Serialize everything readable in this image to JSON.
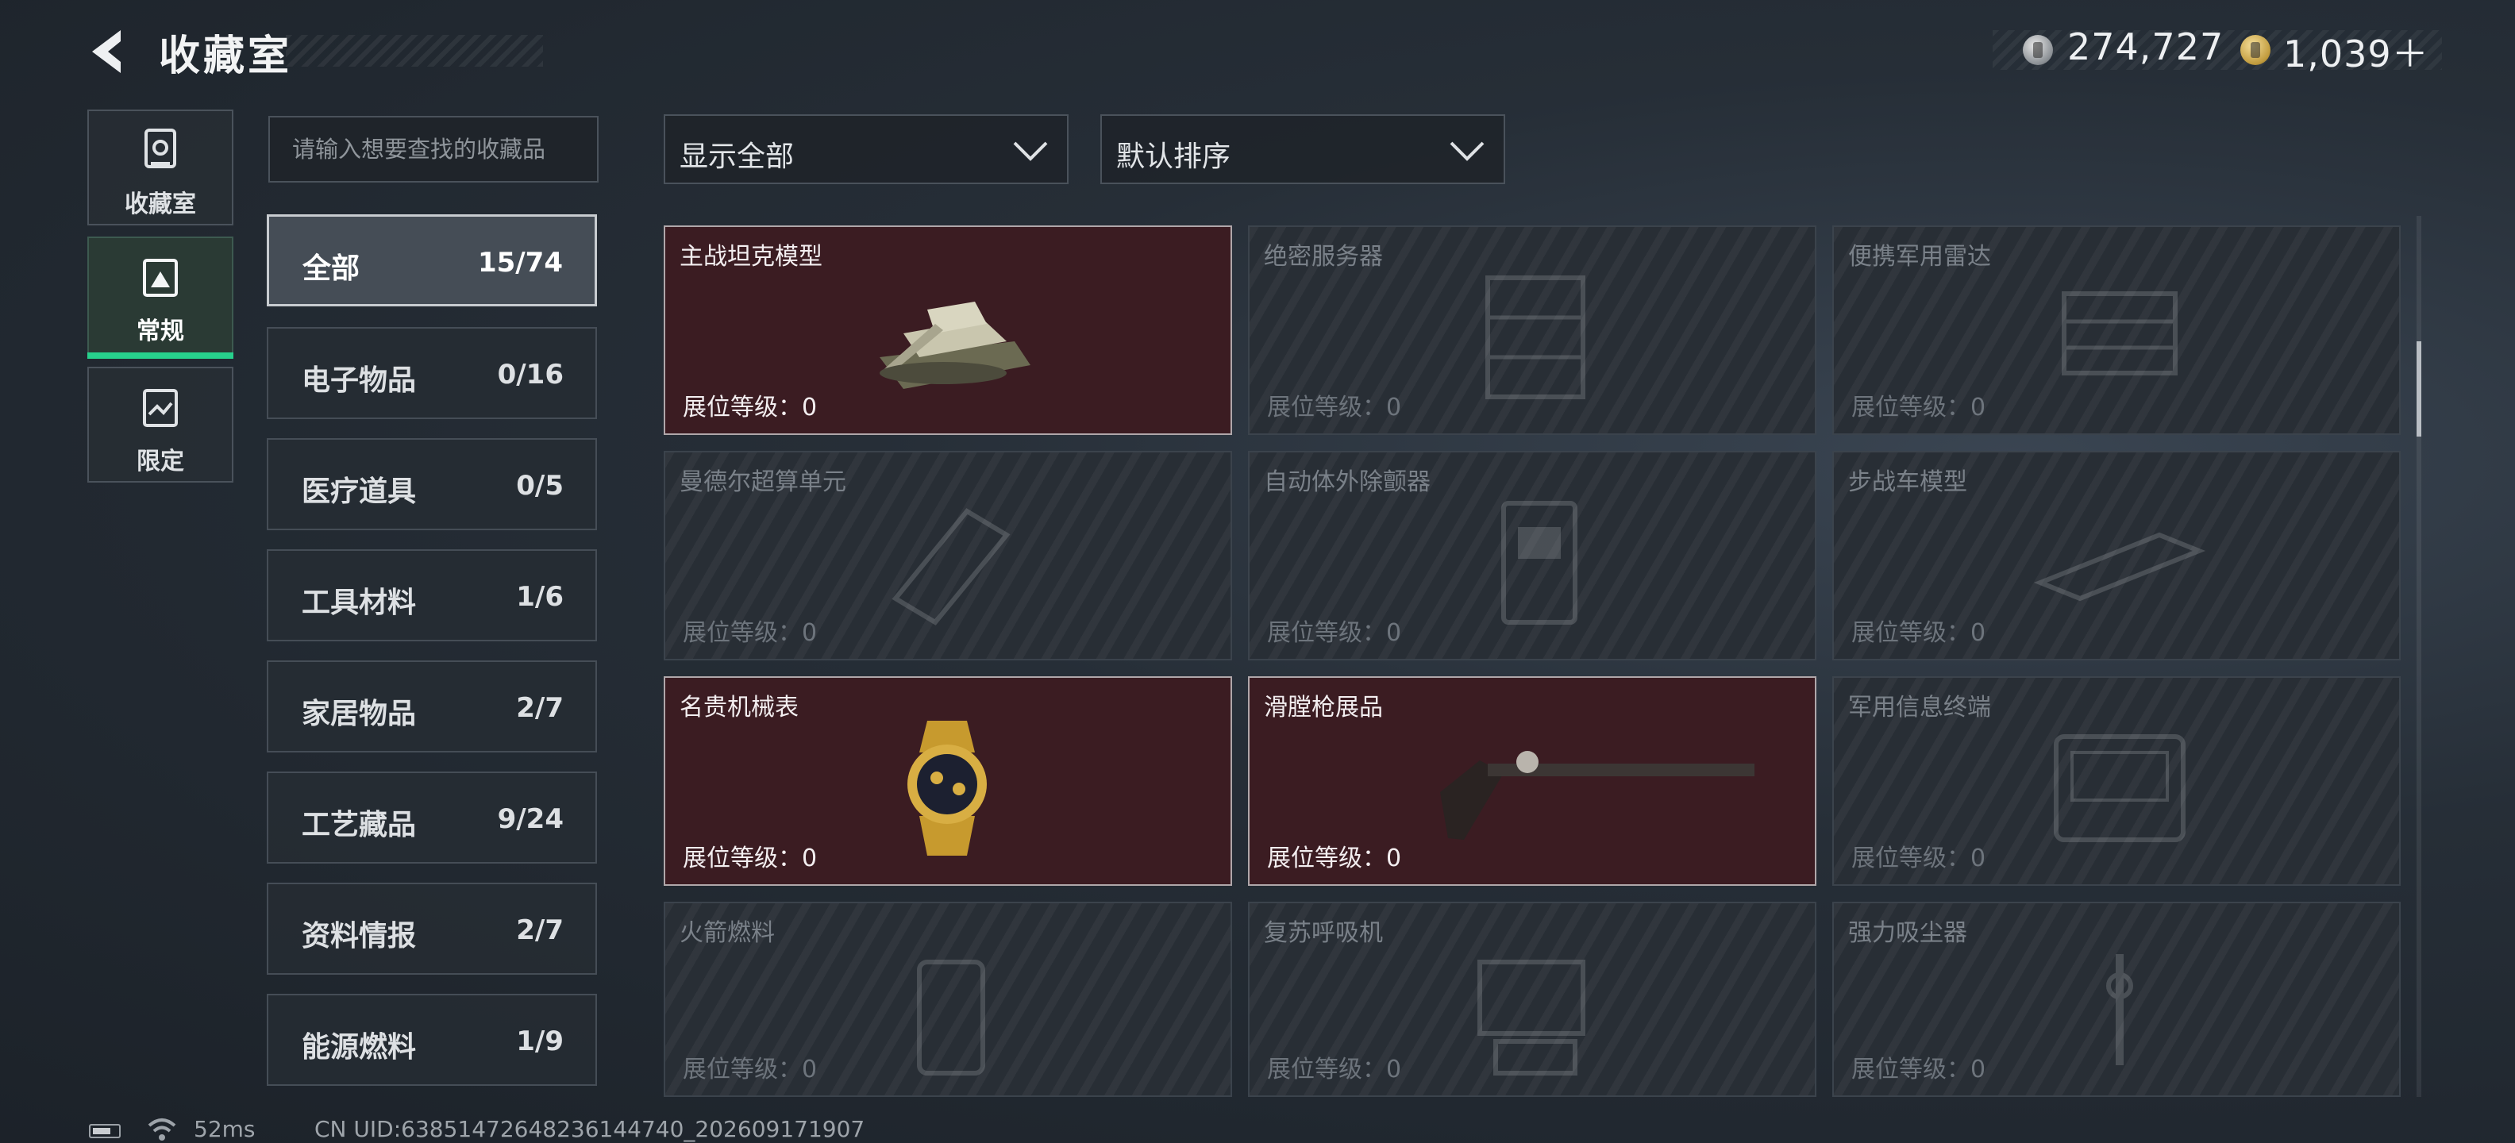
{
  "header": {
    "title": "收藏室",
    "silver_amount": "274,727",
    "gold_amount": "1,039＋"
  },
  "left_nav": [
    {
      "label": "收藏室",
      "icon": "collection-room-icon",
      "active": false
    },
    {
      "label": "常规",
      "icon": "regular-image-icon",
      "active": true
    },
    {
      "label": "限定",
      "icon": "limited-image-icon",
      "active": false
    }
  ],
  "search": {
    "placeholder": "请输入想要查找的收藏品"
  },
  "filters": {
    "filter_value": "显示全部",
    "sort_value": "默认排序"
  },
  "categories": [
    {
      "name": "全部",
      "count": "15/74"
    },
    {
      "name": "电子物品",
      "count": "0/16"
    },
    {
      "name": "医疗道具",
      "count": "0/5"
    },
    {
      "name": "工具材料",
      "count": "1/6"
    },
    {
      "name": "家居物品",
      "count": "2/7"
    },
    {
      "name": "工艺藏品",
      "count": "9/24"
    },
    {
      "name": "资料情报",
      "count": "2/7"
    },
    {
      "name": "能源燃料",
      "count": "1/9"
    }
  ],
  "items": [
    {
      "name": "主战坦克模型",
      "level": "展位等级：0",
      "owned": true,
      "icon": "tank-model-icon"
    },
    {
      "name": "绝密服务器",
      "level": "展位等级：0",
      "owned": false,
      "icon": "server-icon"
    },
    {
      "name": "便携军用雷达",
      "level": "展位等级：0",
      "owned": false,
      "icon": "radar-icon"
    },
    {
      "name": "曼德尔超算单元",
      "level": "展位等级：0",
      "owned": false,
      "icon": "supercomputer-icon"
    },
    {
      "name": "自动体外除颤器",
      "level": "展位等级：0",
      "owned": false,
      "icon": "defibrillator-icon"
    },
    {
      "name": "步战车模型",
      "level": "展位等级：0",
      "owned": false,
      "icon": "ifv-model-icon"
    },
    {
      "name": "名贵机械表",
      "level": "展位等级：0",
      "owned": true,
      "icon": "luxury-watch-icon"
    },
    {
      "name": "滑膛枪展品",
      "level": "展位等级：0",
      "owned": true,
      "icon": "musket-icon"
    },
    {
      "name": "军用信息终端",
      "level": "展位等级：0",
      "owned": false,
      "icon": "terminal-icon"
    },
    {
      "name": "火箭燃料",
      "level": "展位等级：0",
      "owned": false,
      "icon": "rocket-fuel-icon"
    },
    {
      "name": "复苏呼吸机",
      "level": "展位等级：0",
      "owned": false,
      "icon": "ventilator-icon"
    },
    {
      "name": "强力吸尘器",
      "level": "展位等级：0",
      "owned": false,
      "icon": "vacuum-icon"
    }
  ],
  "footer": {
    "ping": "52ms",
    "uid": "CN UID:6385147264823614474​0_202609171907"
  }
}
